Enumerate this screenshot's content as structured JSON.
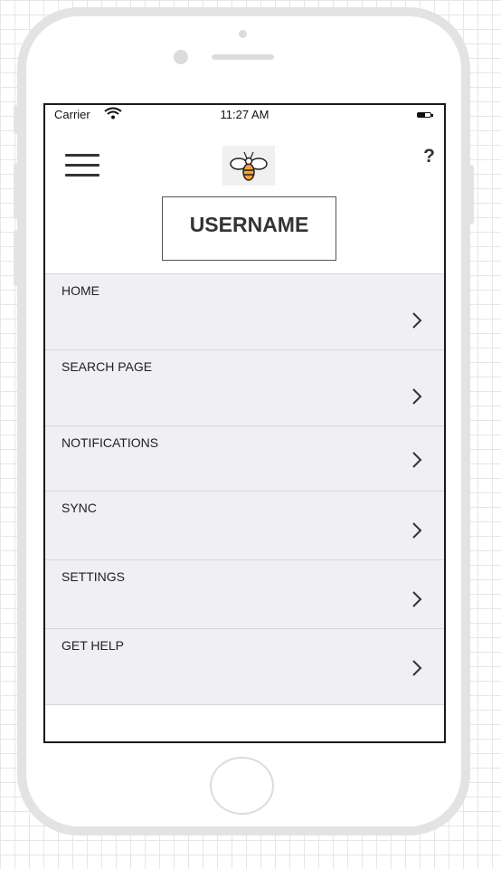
{
  "status_bar": {
    "carrier": "Carrier",
    "time": "11:27 AM"
  },
  "header": {
    "logo_icon": "bee-icon",
    "help_label": "?"
  },
  "profile": {
    "username": "USERNAME"
  },
  "nav": {
    "items": [
      {
        "label": "HOME"
      },
      {
        "label": "SEARCH PAGE"
      },
      {
        "label": "NOTIFICATIONS"
      },
      {
        "label": "SYNC"
      },
      {
        "label": "SETTINGS"
      },
      {
        "label": "GET HELP"
      }
    ]
  },
  "colors": {
    "frame": "#e3e3e3",
    "nav_background": "#efeff4",
    "bee_accent": "#f4a23a"
  }
}
